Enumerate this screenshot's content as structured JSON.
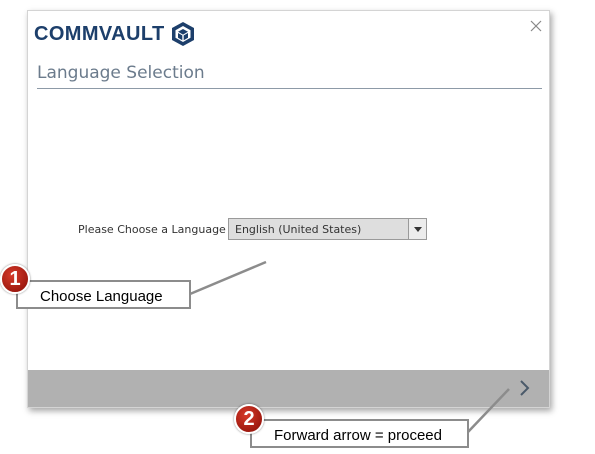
{
  "brand": {
    "name": "COMMVAULT",
    "logo_icon": "commvault-cube-icon"
  },
  "dialog": {
    "title": "Language Selection",
    "close_icon": "close-icon",
    "language_label": "Please Choose a Language",
    "language_selected": "English (United States)",
    "next_icon": "chevron-right-icon"
  },
  "callouts": [
    {
      "number": "1",
      "text": "Choose Language"
    },
    {
      "number": "2",
      "text": "Forward arrow = proceed"
    }
  ],
  "colors": {
    "brand": "#1d3f6b",
    "badge": "#b0231a",
    "footer": "#b1b1b1"
  }
}
